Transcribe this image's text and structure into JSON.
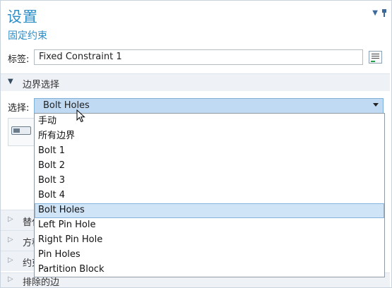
{
  "header": {
    "title": "设置",
    "subtitle": "固定约束"
  },
  "label_field": {
    "label": "标签:",
    "value": "Fixed Constraint 1"
  },
  "boundary_section": {
    "title": "边界选择"
  },
  "selection": {
    "label": "选择:",
    "value": "Bolt Holes",
    "options": [
      "手动",
      "所有边界",
      "Bolt 1",
      "Bolt 2",
      "Bolt 3",
      "Bolt 4",
      "Bolt Holes",
      "Left Pin Hole",
      "Right Pin Hole",
      "Pin Holes",
      "Partition Block"
    ],
    "selected_index": 6
  },
  "collapsed_sections": [
    {
      "label": "替代"
    },
    {
      "label": "方程"
    },
    {
      "label": "约束"
    }
  ],
  "last_section": {
    "label": "排除的边"
  },
  "colors": {
    "accent": "#2f8ec6",
    "selected_bg": "#cfe4f7",
    "section_bg": "#eef1f5"
  }
}
